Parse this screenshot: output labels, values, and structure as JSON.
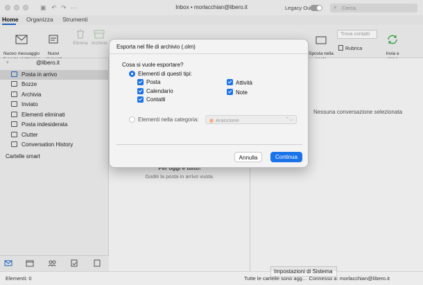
{
  "window": {
    "title": "Inbox • morlacchian@libero.it",
    "legacy_label": "Legacy Outlook",
    "search_placeholder": "Cerca"
  },
  "tabs": [
    "Home",
    "Organizza",
    "Strumenti"
  ],
  "ribbon": {
    "new_message": "Nuovo messaggio\ndi posta elettronica",
    "new_items": "Nuovi\nelementi",
    "delete": "Elimina",
    "archive": "Archivia",
    "move_to_mail": "Sposta nella posta\nelettronica",
    "find_contacts_placeholder": "Trova contatti",
    "address_book": "Rubrica",
    "send_receive": "Invia e\nricevi"
  },
  "sidebar": {
    "account": "@libero.it",
    "folders": [
      {
        "label": "Posta in arrivo",
        "icon": "inbox-icon",
        "selected": true
      },
      {
        "label": "Bozze",
        "icon": "drafts-icon",
        "selected": false
      },
      {
        "label": "Archivia",
        "icon": "archive-icon",
        "selected": false
      },
      {
        "label": "Inviato",
        "icon": "sent-icon",
        "selected": false
      },
      {
        "label": "Elementi eliminati",
        "icon": "trash-icon",
        "selected": false
      },
      {
        "label": "Posta indesiderata",
        "icon": "junk-icon",
        "selected": false
      },
      {
        "label": "Clutter",
        "icon": "folder-icon",
        "selected": false
      },
      {
        "label": "Conversation History",
        "icon": "folder-icon",
        "selected": false
      }
    ],
    "smart_folders": "Cartelle smart"
  },
  "list_pane": {
    "empty_title": "Per oggi è tutto!",
    "empty_subtitle": "Goditi la posta in arrivo vuota."
  },
  "reading_pane": {
    "no_selection": "Nessuna conversazione selezionata"
  },
  "status": {
    "items": "Elementi: 0",
    "right": "Tutte le cartelle sono agg…   Connesso a: morlacchian@libero.it",
    "system_prefs_tooltip": "Impostazioni di Sistema"
  },
  "dialog": {
    "title": "Esporta nel file di archivio (.olm)",
    "question": "Cosa si vuole esportare?",
    "option_types": "Elementi di questi tipi:",
    "types_left": [
      "Posta",
      "Calendario",
      "Contatti"
    ],
    "types_right": [
      "Attività",
      "Note"
    ],
    "option_category": "Elementi nella categoria:",
    "category_value": "Arancione",
    "cancel": "Annulla",
    "ok": "Continua"
  },
  "colors": {
    "accent": "#1a73e8",
    "category_orange": "#f2b38a"
  }
}
